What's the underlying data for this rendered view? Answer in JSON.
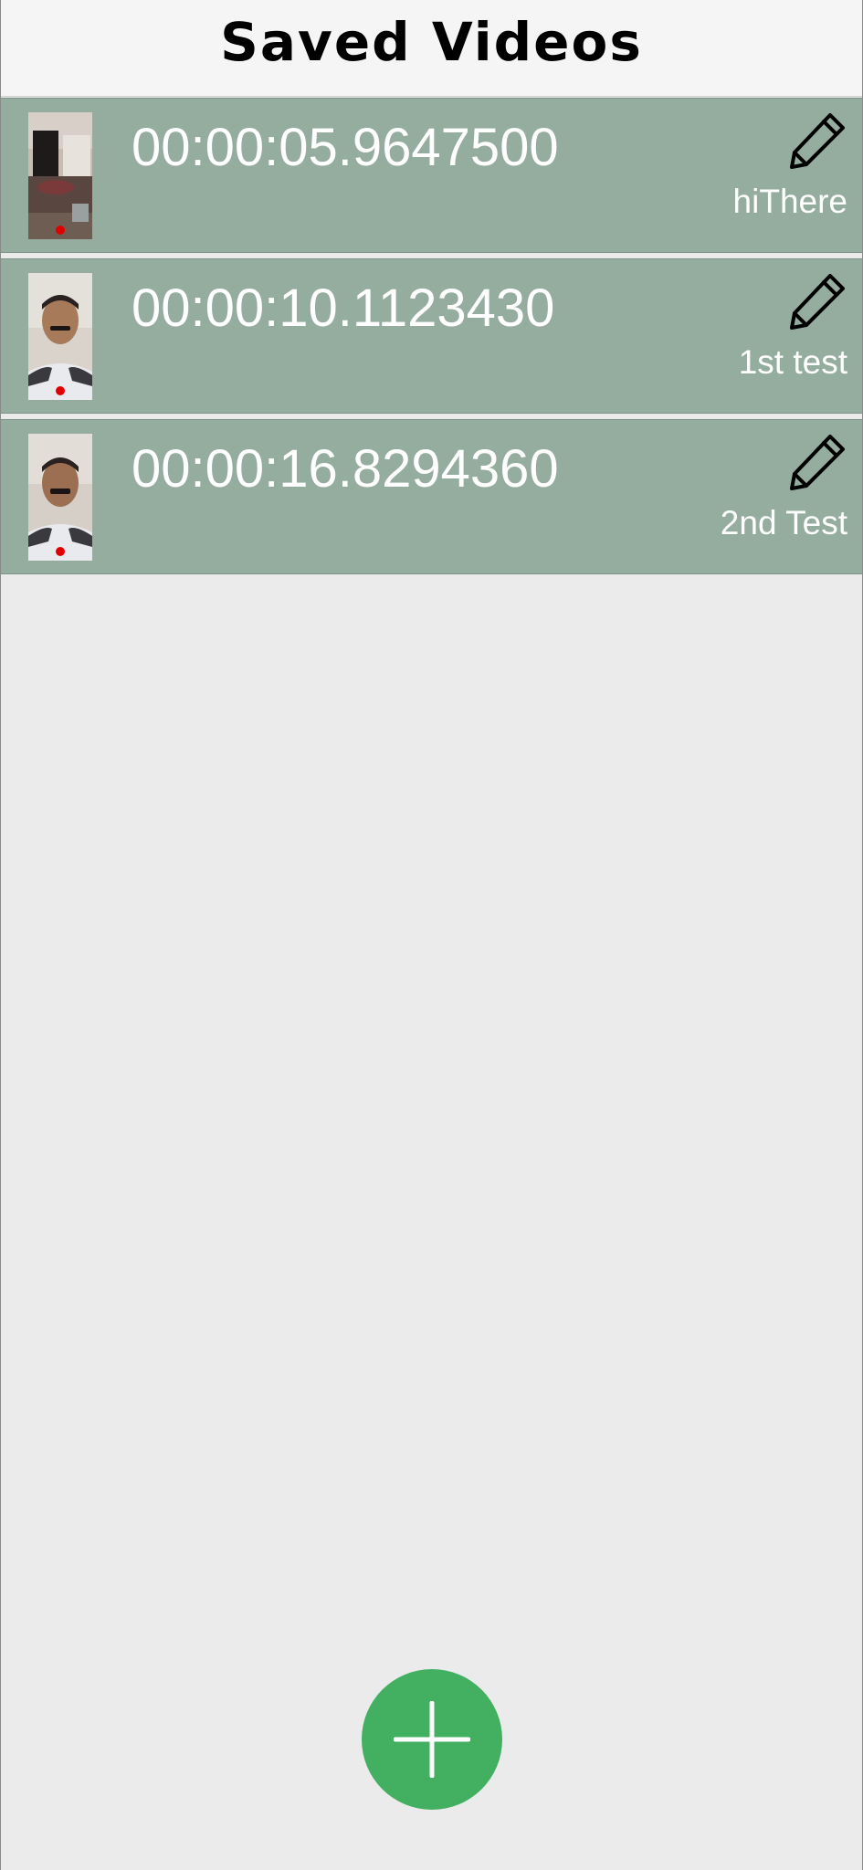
{
  "header": {
    "title": "Saved Videos"
  },
  "videos": [
    {
      "duration": "00:00:05.9647500",
      "name": "hiThere",
      "thumbnail": "room-thumbnail"
    },
    {
      "duration": "00:00:10.1123430",
      "name": "1st test",
      "thumbnail": "face-thumbnail"
    },
    {
      "duration": "00:00:16.8294360",
      "name": "2nd Test",
      "thumbnail": "face-thumbnail"
    }
  ],
  "icons": {
    "edit": "pencil-icon",
    "add": "plus-icon"
  },
  "colors": {
    "list_item_bg": "#95ad9f",
    "fab_bg": "#43b061",
    "record_dot": "#e00000"
  }
}
